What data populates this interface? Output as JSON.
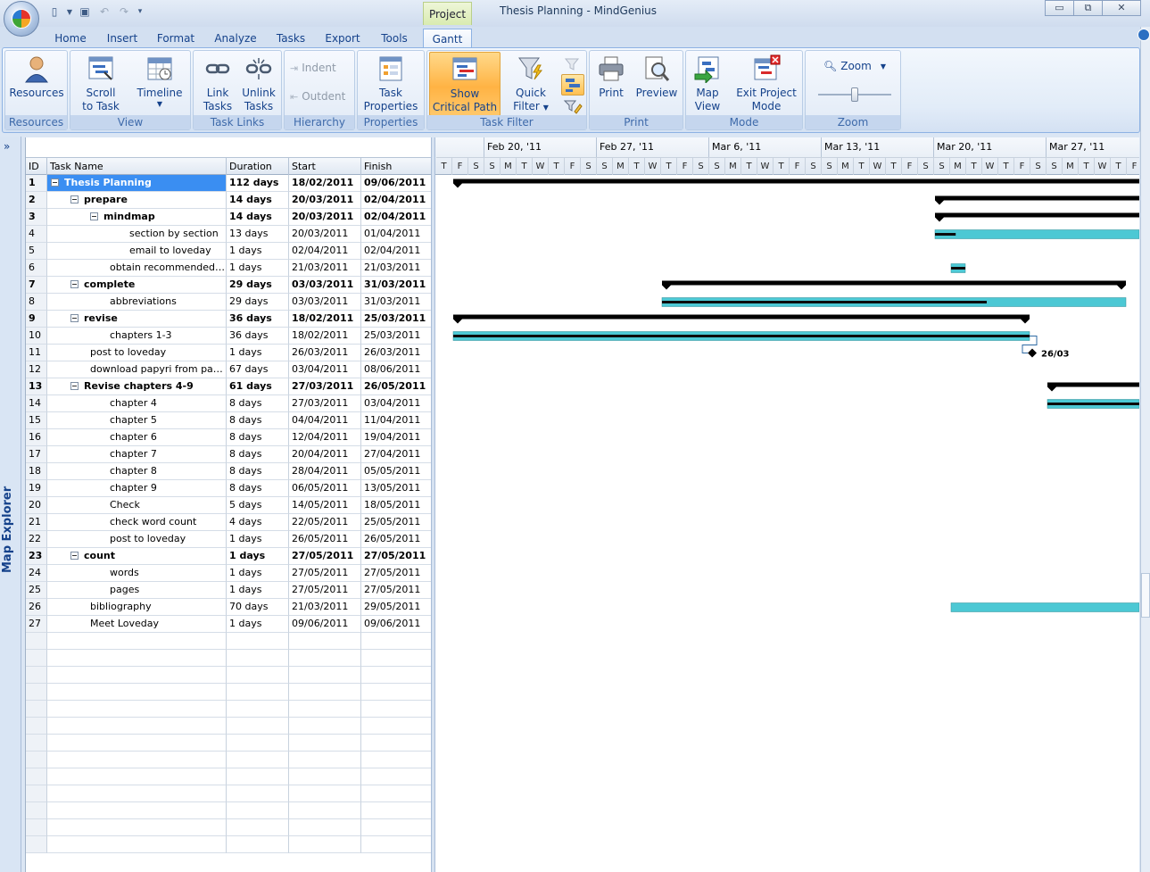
{
  "window": {
    "title": "Thesis Planning - MindGenius",
    "context_tab": "Project",
    "controls": {
      "minimize": "▭",
      "restore": "⧉",
      "close": "✕"
    }
  },
  "ribbon_tabs": [
    "Home",
    "Insert",
    "Format",
    "Analyze",
    "Tasks",
    "Export",
    "Tools",
    "Gantt"
  ],
  "ribbon": {
    "groups": {
      "resources": "Resources",
      "view": "View",
      "task_links": "Task Links",
      "hierarchy": "Hierarchy",
      "properties": "Properties",
      "task_filter": "Task Filter",
      "print": "Print",
      "mode": "Mode",
      "zoom": "Zoom"
    },
    "buttons": {
      "resources": "Resources",
      "scroll_line1": "Scroll",
      "scroll_line2": "to Task",
      "timeline": "Timeline",
      "link_line1": "Link",
      "link_line2": "Tasks",
      "unlink_line1": "Unlink",
      "unlink_line2": "Tasks",
      "indent": "Indent",
      "outdent": "Outdent",
      "taskprops_line1": "Task",
      "taskprops_line2": "Properties",
      "critical_line1": "Show",
      "critical_line2": "Critical Path",
      "quick_line1": "Quick",
      "quick_line2": "Filter",
      "print": "Print",
      "preview": "Preview",
      "mapview_line1": "Map",
      "mapview_line2": "View",
      "exit_line1": "Exit Project",
      "exit_line2": "Mode",
      "zoom": "Zoom"
    },
    "zoom_level": 0.5
  },
  "sidebar": {
    "toggle": "»",
    "label": "Map Explorer"
  },
  "grid": {
    "columns": [
      "ID",
      "Task Name",
      "Duration",
      "Start",
      "Finish"
    ],
    "rows": [
      {
        "id": "1",
        "name": "Thesis Planning",
        "duration": "112 days",
        "start": "18/02/2011",
        "finish": "09/06/2011"
      },
      {
        "id": "2",
        "name": "prepare",
        "duration": "14 days",
        "start": "20/03/2011",
        "finish": "02/04/2011"
      },
      {
        "id": "3",
        "name": "mindmap",
        "duration": "14 days",
        "start": "20/03/2011",
        "finish": "02/04/2011"
      },
      {
        "id": "4",
        "name": "section by section",
        "duration": "13 days",
        "start": "20/03/2011",
        "finish": "01/04/2011"
      },
      {
        "id": "5",
        "name": "email to loveday",
        "duration": "1 days",
        "start": "02/04/2011",
        "finish": "02/04/2011"
      },
      {
        "id": "6",
        "name": "obtain recommended boo...",
        "duration": "1 days",
        "start": "21/03/2011",
        "finish": "21/03/2011"
      },
      {
        "id": "7",
        "name": "complete",
        "duration": "29 days",
        "start": "03/03/2011",
        "finish": "31/03/2011"
      },
      {
        "id": "8",
        "name": "abbreviations",
        "duration": "29 days",
        "start": "03/03/2011",
        "finish": "31/03/2011"
      },
      {
        "id": "9",
        "name": "revise",
        "duration": "36 days",
        "start": "18/02/2011",
        "finish": "25/03/2011"
      },
      {
        "id": "10",
        "name": "chapters 1-3",
        "duration": "36 days",
        "start": "18/02/2011",
        "finish": "25/03/2011"
      },
      {
        "id": "11",
        "name": "post to loveday",
        "duration": "1 days",
        "start": "26/03/2011",
        "finish": "26/03/2011"
      },
      {
        "id": "12",
        "name": "download papyri from papyri...",
        "duration": "67 days",
        "start": "03/04/2011",
        "finish": "08/06/2011"
      },
      {
        "id": "13",
        "name": "Revise chapters 4-9",
        "duration": "61 days",
        "start": "27/03/2011",
        "finish": "26/05/2011"
      },
      {
        "id": "14",
        "name": "chapter 4",
        "duration": "8 days",
        "start": "27/03/2011",
        "finish": "03/04/2011"
      },
      {
        "id": "15",
        "name": "chapter 5",
        "duration": "8 days",
        "start": "04/04/2011",
        "finish": "11/04/2011"
      },
      {
        "id": "16",
        "name": "chapter 6",
        "duration": "8 days",
        "start": "12/04/2011",
        "finish": "19/04/2011"
      },
      {
        "id": "17",
        "name": "chapter 7",
        "duration": "8 days",
        "start": "20/04/2011",
        "finish": "27/04/2011"
      },
      {
        "id": "18",
        "name": "chapter 8",
        "duration": "8 days",
        "start": "28/04/2011",
        "finish": "05/05/2011"
      },
      {
        "id": "19",
        "name": "chapter 9",
        "duration": "8 days",
        "start": "06/05/2011",
        "finish": "13/05/2011"
      },
      {
        "id": "20",
        "name": "Check",
        "duration": "5 days",
        "start": "14/05/2011",
        "finish": "18/05/2011"
      },
      {
        "id": "21",
        "name": "check word count",
        "duration": "4 days",
        "start": "22/05/2011",
        "finish": "25/05/2011"
      },
      {
        "id": "22",
        "name": "post to loveday",
        "duration": "1 days",
        "start": "26/05/2011",
        "finish": "26/05/2011"
      },
      {
        "id": "23",
        "name": "count",
        "duration": "1 days",
        "start": "27/05/2011",
        "finish": "27/05/2011"
      },
      {
        "id": "24",
        "name": "words",
        "duration": "1 days",
        "start": "27/05/2011",
        "finish": "27/05/2011"
      },
      {
        "id": "25",
        "name": "pages",
        "duration": "1 days",
        "start": "27/05/2011",
        "finish": "27/05/2011"
      },
      {
        "id": "26",
        "name": "bibliography",
        "duration": "70 days",
        "start": "21/03/2011",
        "finish": "29/05/2011"
      },
      {
        "id": "27",
        "name": "Meet Loveday",
        "duration": "1 days",
        "start": "09/06/2011",
        "finish": "09/06/2011"
      }
    ]
  },
  "gantt": {
    "weeks": [
      "Feb 20, '11",
      "Feb 27, '11",
      "Mar 6, '11",
      "Mar 13, '11",
      "Mar 20, '11",
      "Mar 27, '11"
    ],
    "days": [
      "T",
      "F",
      "S",
      "S",
      "M",
      "T",
      "W",
      "T",
      "F",
      "S",
      "S",
      "M",
      "T",
      "W",
      "T",
      "F",
      "S",
      "S",
      "M",
      "T",
      "W",
      "T",
      "F",
      "S",
      "S",
      "M",
      "T",
      "W",
      "T",
      "F",
      "S",
      "S",
      "M",
      "T",
      "W",
      "T",
      "F",
      "S",
      "S",
      "M",
      "T",
      "W",
      "T",
      "F"
    ],
    "milestone_label": "26/03",
    "colors": {
      "summary": "#000000",
      "task": "#4cc8d4",
      "progress": "#0b0b0b",
      "link": "#2f6aa3"
    }
  }
}
